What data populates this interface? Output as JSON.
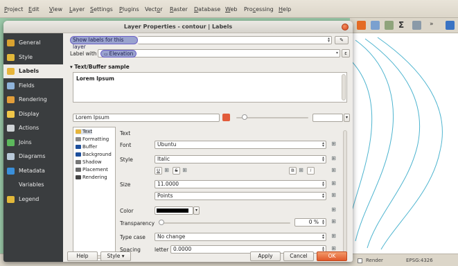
{
  "menubar": {
    "items": [
      {
        "pre": "",
        "u": "P",
        "post": "roject"
      },
      {
        "pre": "",
        "u": "E",
        "post": "dit"
      },
      {
        "pre": "",
        "u": "V",
        "post": "iew"
      },
      {
        "pre": "",
        "u": "L",
        "post": "ayer"
      },
      {
        "pre": "",
        "u": "S",
        "post": "ettings"
      },
      {
        "pre": "",
        "u": "P",
        "post": "lugins"
      },
      {
        "pre": "Vect",
        "u": "o",
        "post": "r"
      },
      {
        "pre": "",
        "u": "R",
        "post": "aster"
      },
      {
        "pre": "",
        "u": "D",
        "post": "atabase"
      },
      {
        "pre": "",
        "u": "W",
        "post": "eb"
      },
      {
        "pre": "Pro",
        "u": "c",
        "post": "essing"
      },
      {
        "pre": "",
        "u": "H",
        "post": "elp"
      }
    ]
  },
  "dialog": {
    "title": "Layer Properties - contour | Labels"
  },
  "sidebar": {
    "items": [
      {
        "label": "General",
        "icon": "wrench-icon",
        "color": "#d9a230"
      },
      {
        "label": "Style",
        "icon": "paintbrush-icon",
        "color": "#e2b83a"
      },
      {
        "label": "Labels",
        "icon": "labels-icon",
        "color": "#e7b53b"
      },
      {
        "label": "Fields",
        "icon": "table-icon",
        "color": "#8fb3d9"
      },
      {
        "label": "Rendering",
        "icon": "brush-icon",
        "color": "#e29e3a"
      },
      {
        "label": "Display",
        "icon": "speech-bubble-icon",
        "color": "#f0c649"
      },
      {
        "label": "Actions",
        "icon": "gear-icon",
        "color": "#cfd3d6"
      },
      {
        "label": "Joins",
        "icon": "join-icon",
        "color": "#5cb85c"
      },
      {
        "label": "Diagrams",
        "icon": "diagram-icon",
        "color": "#b8c8d8"
      },
      {
        "label": "Metadata",
        "icon": "info-icon",
        "color": "#3a8fd9"
      },
      {
        "label": "Variables",
        "icon": "variables-icon",
        "color": "#3a3d3f"
      },
      {
        "label": "Legend",
        "icon": "legend-icon",
        "color": "#e2b83a"
      }
    ]
  },
  "labels": {
    "mode": "Show labels for this layer",
    "label_with": "Label with",
    "field": "Elevation",
    "sample_header": "Text/Buffer sample",
    "sample_text": "Lorem Ipsum",
    "sample_input": "Lorem Ipsum"
  },
  "tree": {
    "items": [
      "Text",
      "Formatting",
      "Buffer",
      "Background",
      "Shadow",
      "Placement",
      "Rendering"
    ]
  },
  "text_panel": {
    "section": "Text",
    "font_label": "Font",
    "font_value": "Ubuntu",
    "style_label": "Style",
    "style_value": "Italic",
    "fmt_buttons": [
      "U",
      "S",
      "B",
      "I"
    ],
    "size_label": "Size",
    "size_value": "11.0000",
    "units_value": "Points",
    "color_label": "Color",
    "color_value": "#000000",
    "transparency_label": "Transparency",
    "transparency_value": "0 %",
    "transparency_level": 0,
    "typecase_label": "Type case",
    "typecase_value": "No change",
    "spacing_label": "Spacing",
    "spacing_sub": "letter",
    "spacing_value": "0.0000"
  },
  "buttons": {
    "help": "Help",
    "style": "Style",
    "apply": "Apply",
    "cancel": "Cancel",
    "ok": "OK"
  },
  "statusbar": {
    "render": "Render",
    "crs": "EPSG:4326"
  }
}
